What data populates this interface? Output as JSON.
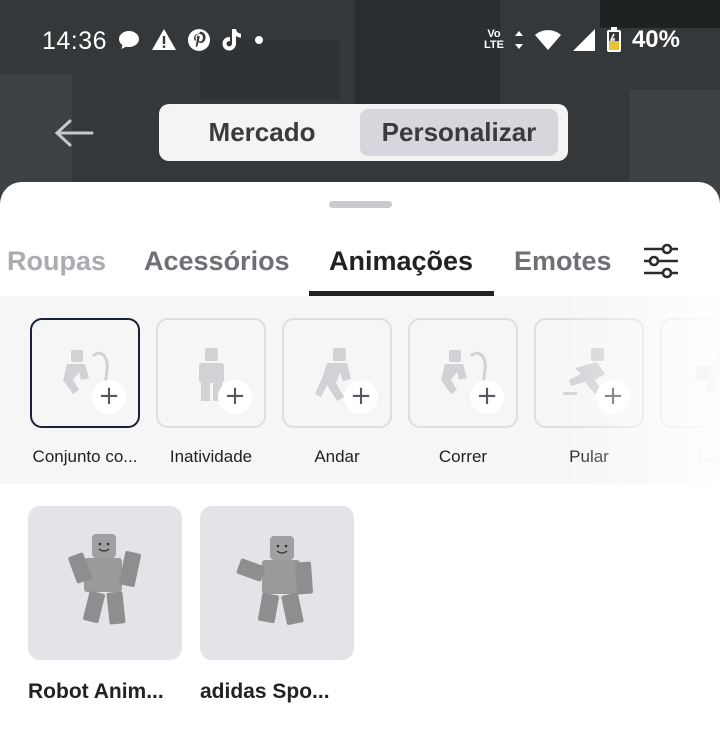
{
  "status_bar": {
    "time": "14:36",
    "battery": "40%",
    "network_top": "Vo",
    "network_bottom": "LTE",
    "icons": [
      "chat-bubble-icon",
      "warning-icon",
      "pinterest-icon",
      "tiktok-icon",
      "dot-icon",
      "wifi-icon",
      "signal-icon",
      "battery-icon"
    ]
  },
  "header": {
    "segments": [
      "Mercado",
      "Personalizar"
    ],
    "selected_segment": "Personalizar"
  },
  "tabs": {
    "items": [
      "Roupas",
      "Acessórios",
      "Animações",
      "Emotes"
    ],
    "selected": "Animações"
  },
  "slots": [
    {
      "label": "Conjunto co...",
      "icon": "run-jump-figure-icon",
      "selected": true
    },
    {
      "label": "Inatividade",
      "icon": "idle-figure-icon",
      "selected": false
    },
    {
      "label": "Andar",
      "icon": "walk-figure-icon",
      "selected": false
    },
    {
      "label": "Correr",
      "icon": "run-figure-icon",
      "selected": false
    },
    {
      "label": "Pular",
      "icon": "jump-figure-icon",
      "selected": false
    },
    {
      "label": "Ca",
      "icon": "fall-figure-icon",
      "selected": false
    }
  ],
  "items": [
    {
      "name": "Robot Anim...",
      "icon": "robot-avatar"
    },
    {
      "name": "adidas Spo...",
      "icon": "adidas-avatar"
    }
  ],
  "colors": {
    "selected_border": "#1a2238",
    "tab_active": "#202225",
    "segment_active_bg": "#d5d7dd"
  }
}
